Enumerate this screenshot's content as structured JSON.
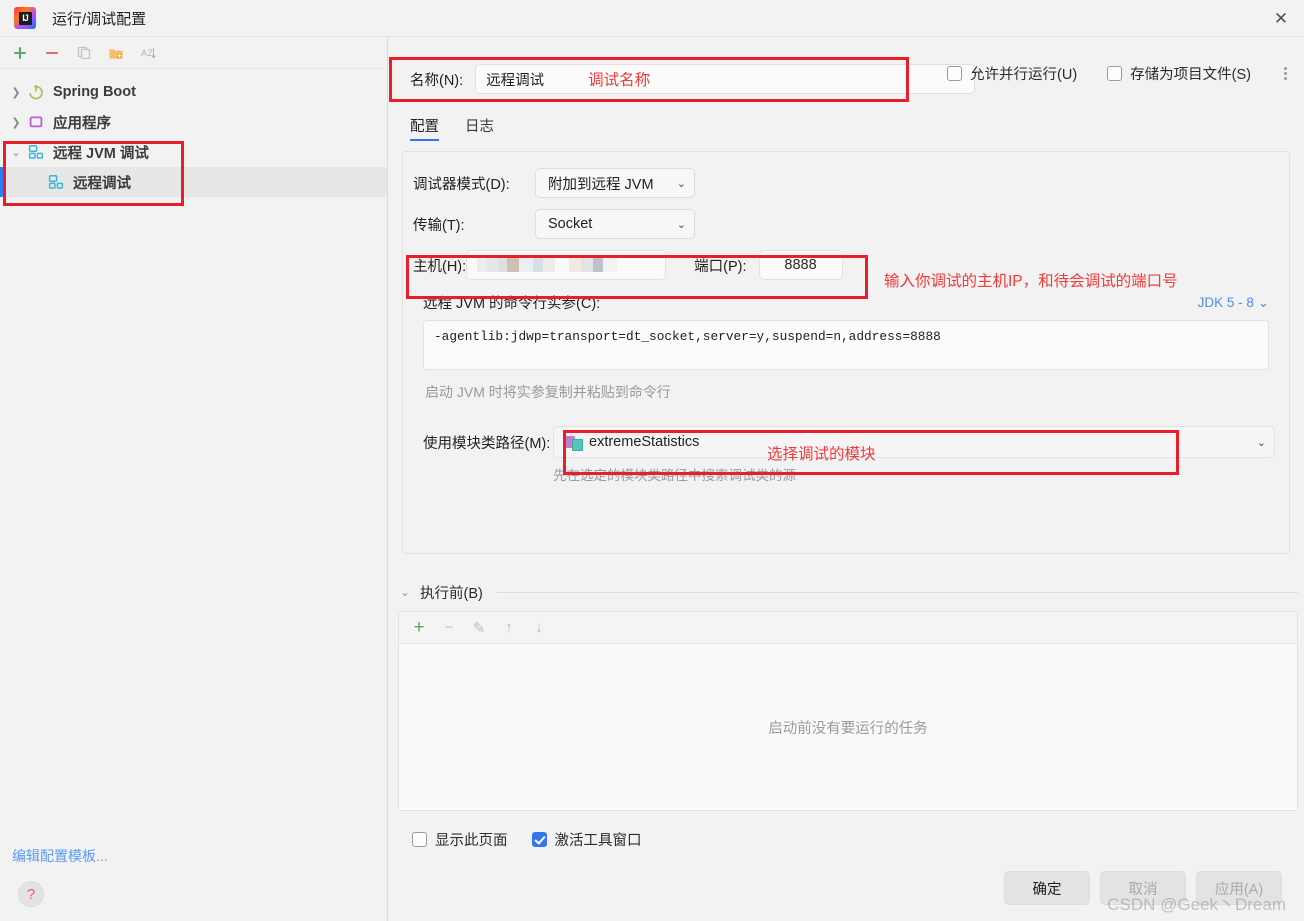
{
  "window": {
    "title": "运行/调试配置",
    "close_label": "✕",
    "app_icon": "intellij-idea-icon"
  },
  "sidebar": {
    "toolbar": [
      {
        "name": "add-configuration-button",
        "glyph": "+"
      },
      {
        "name": "remove-configuration-button",
        "glyph": "−"
      },
      {
        "name": "copy-configuration-button",
        "glyph": "copy"
      },
      {
        "name": "new-folder-button",
        "glyph": "folder-plus"
      },
      {
        "name": "sort-alphabetically-button",
        "glyph": "AZ"
      }
    ],
    "tree": [
      {
        "label": "Spring Boot",
        "expanded": false,
        "icon": "spring-boot-icon",
        "level": 0,
        "selected": false
      },
      {
        "label": "应用程序",
        "expanded": false,
        "icon": "application-icon",
        "level": 0,
        "selected": false
      },
      {
        "label": "远程 JVM 调试",
        "expanded": true,
        "icon": "remote-jvm-debug-icon",
        "level": 0,
        "selected": false
      },
      {
        "label": "远程调试",
        "expanded": null,
        "icon": "remote-jvm-debug-icon",
        "level": 1,
        "selected": true
      }
    ],
    "edit_templates_link": "编辑配置模板...",
    "help_glyph": "?"
  },
  "main": {
    "name_label": "名称(N):",
    "name_value": "远程调试",
    "allow_parallel_label": "允许并行运行(U)",
    "allow_parallel_checked": false,
    "store_as_project_label": "存储为项目文件(S)",
    "store_as_project_checked": false,
    "tabs": [
      {
        "label": "配置",
        "active": true
      },
      {
        "label": "日志",
        "active": false
      }
    ],
    "debugger_mode_label": "调试器模式(D):",
    "debugger_mode_value": "附加到远程 JVM",
    "transport_label": "传输(T):",
    "transport_value": "Socket",
    "host_label": "主机(H):",
    "host_value": "",
    "port_label": "端口(P):",
    "port_value": "8888",
    "args_label": "远程 JVM 的命令行实参(C):",
    "jdk_selector": "JDK 5 - 8",
    "args_value": "-agentlib:jdwp=transport=dt_socket,server=y,suspend=n,address=8888",
    "args_hint": "启动 JVM 时将实参复制并粘贴到命令行",
    "module_label": "使用模块类路径(M):",
    "module_value": "extremeStatistics",
    "module_hint": "先在选定的模块类路径中搜索调试类的源",
    "before_launch_label": "执行前(B)",
    "before_launch_toolbar": [
      {
        "name": "add-task-button",
        "glyph": "+"
      },
      {
        "name": "remove-task-button",
        "glyph": "−"
      },
      {
        "name": "edit-task-button",
        "glyph": "✎"
      },
      {
        "name": "move-task-up-button",
        "glyph": "↑"
      },
      {
        "name": "move-task-down-button",
        "glyph": "↓"
      }
    ],
    "before_launch_empty": "启动前没有要运行的任务",
    "show_page_label": "显示此页面",
    "show_page_checked": false,
    "activate_tool_window_label": "激活工具窗口",
    "activate_tool_window_checked": true
  },
  "footer": {
    "ok_label": "确定",
    "cancel_label": "取消",
    "apply_label": "应用(A)"
  },
  "annotations": {
    "name_note": "调试名称",
    "host_note": "输入你调试的主机IP，和待会调试的端口号",
    "module_note": "选择调试的模块",
    "color": "#ef3b3b",
    "box_color": "#e81f2a"
  },
  "watermark": "CSDN @Geek丶Dream"
}
